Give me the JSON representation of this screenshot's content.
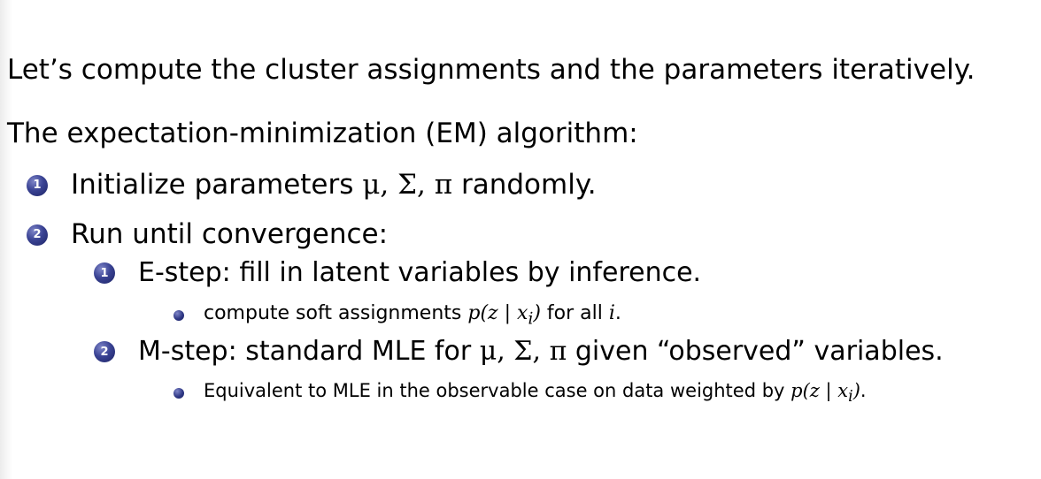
{
  "intro": "Let’s compute the cluster assignments and the parameters iteratively.",
  "algorithm_heading": "The expectation-minimization (EM) algorithm:",
  "steps": [
    {
      "number": "1",
      "text_before": "Initialize parameters ",
      "math": "μ, Σ, π",
      "text_after": " randomly."
    },
    {
      "number": "2",
      "text": "Run until convergence:",
      "substeps": [
        {
          "number": "1",
          "text": "E-step: fill in latent variables by inference.",
          "bullet": {
            "text_before": "compute soft assignments ",
            "math": "p(z | x",
            "math_sub": "i",
            "math_close": ")",
            "text_middle": " for all ",
            "math_var": "i",
            "text_after": "."
          }
        },
        {
          "number": "2",
          "text_before": "M-step: standard MLE for ",
          "math": "μ, Σ, π",
          "text_after": " given “observed” variables.",
          "bullet": {
            "text_before": "Equivalent to MLE in the observable case on data weighted by ",
            "math": "p(z | x",
            "math_sub": "i",
            "math_close": ")",
            "text_after": "."
          }
        }
      ]
    }
  ],
  "colors": {
    "bullet_ball": "#2e3784",
    "text": "#000000"
  }
}
